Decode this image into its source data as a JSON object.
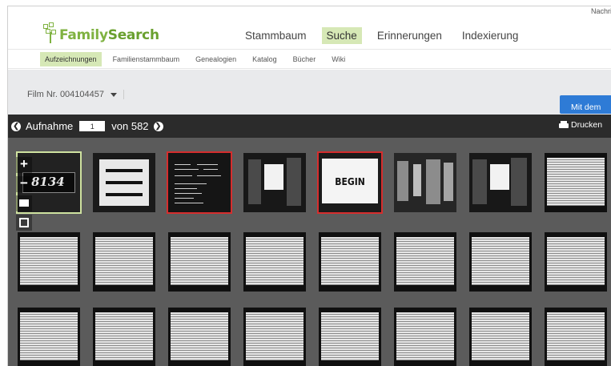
{
  "brand": {
    "logo_text_a": "Family",
    "logo_text_b": "Search"
  },
  "top_right": {
    "messages_label": "Nachri"
  },
  "main_nav": [
    {
      "label": "Stammbaum",
      "active": false
    },
    {
      "label": "Suche",
      "active": true
    },
    {
      "label": "Erinnerungen",
      "active": false
    },
    {
      "label": "Indexierung",
      "active": false
    }
  ],
  "sub_nav": [
    {
      "label": "Aufzeichnungen",
      "active": true
    },
    {
      "label": "Familienstammbaum",
      "active": false
    },
    {
      "label": "Genealogien",
      "active": false
    },
    {
      "label": "Katalog",
      "active": false
    },
    {
      "label": "Bücher",
      "active": false
    },
    {
      "label": "Wiki",
      "active": false
    }
  ],
  "film": {
    "label": "Film Nr. 004104457",
    "action_button": "Mit dem"
  },
  "image_toolbar": {
    "image_label": "Aufnahme",
    "current_image": "1",
    "total_label": "von 582",
    "print_label": "Drucken"
  },
  "thumbnails": {
    "row1": [
      {
        "kind": "number-plate",
        "text": "8134",
        "selected": true,
        "marked": false
      },
      {
        "kind": "bars-card",
        "selected": false,
        "marked": false
      },
      {
        "kind": "typed-doc",
        "selected": false,
        "marked": true
      },
      {
        "kind": "sign-card",
        "selected": false,
        "marked": false
      },
      {
        "kind": "begin-card",
        "text": "BEGIN",
        "selected": false,
        "marked": true
      },
      {
        "kind": "dark-blocks",
        "selected": false,
        "marked": false
      },
      {
        "kind": "sign-card",
        "selected": false,
        "marked": false
      },
      {
        "kind": "book-page",
        "selected": false,
        "marked": false
      }
    ],
    "page_rows": 2,
    "page_cols": 8
  },
  "colors": {
    "brand_green": "#7fb241",
    "active_tab_bg": "#d6e8b6",
    "toolbar_bg": "#2b2b2b",
    "grid_bg": "#5b5b5b",
    "primary_button": "#2e7bd6",
    "marker_red": "#d62d2d"
  },
  "icons": {
    "prev": "chevron-left-circle-icon",
    "next": "chevron-right-circle-icon",
    "print": "printer-icon",
    "zoom_in": "plus-icon",
    "zoom_out": "minus-icon",
    "fit": "fit-screen-icon",
    "fullscreen": "fullscreen-icon",
    "caret": "caret-down-icon"
  }
}
